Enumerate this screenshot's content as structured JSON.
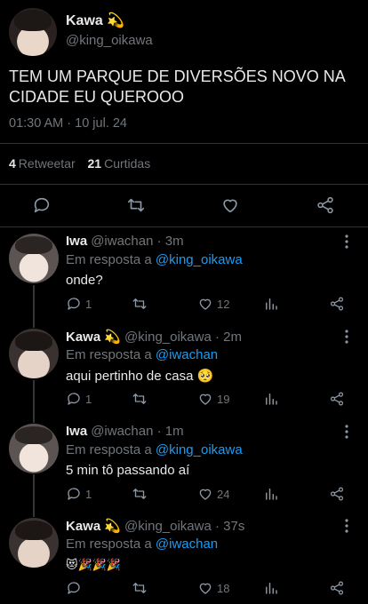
{
  "main_tweet": {
    "name": "Kawa",
    "name_emoji": "💫",
    "handle": "@king_oikawa",
    "text": "TEM UM PARQUE DE DIVERSÕES NOVO NA CIDADE EU QUEROOO",
    "time": "01:30 AM · 10 jul. 24",
    "retweets_count": "4",
    "retweets_label": "Retweetar",
    "likes_count": "21",
    "likes_label": "Curtidas"
  },
  "replies": [
    {
      "name": "Iwa",
      "handle_time": "@iwachan · 3m",
      "reply_prefix": "Em resposta a",
      "reply_to": "@king_oikawa",
      "text": "onde?",
      "replies": "1",
      "likes": "12"
    },
    {
      "name": "Kawa",
      "name_emoji": "💫",
      "handle_time": "@king_oikawa · 2m",
      "reply_prefix": "Em resposta a",
      "reply_to": "@iwachan",
      "text": "aqui pertinho de casa",
      "text_emoji": "🥺",
      "replies": "1",
      "likes": "19"
    },
    {
      "name": "Iwa",
      "handle_time": "@iwachan · 1m",
      "reply_prefix": "Em resposta a",
      "reply_to": "@king_oikawa",
      "text": "5 min tô passando aí",
      "replies": "1",
      "likes": "24"
    },
    {
      "name": "Kawa",
      "name_emoji": "💫",
      "handle_time": "@king_oikawa · 37s",
      "reply_prefix": "Em resposta a",
      "reply_to": "@iwachan",
      "text_emojis": "😻🎉🎉🎉",
      "replies": "",
      "likes": "18"
    }
  ],
  "icons": {
    "reply": "reply-icon",
    "retweet": "retweet-icon",
    "like": "heart-icon",
    "share": "share-icon",
    "analytics": "analytics-icon",
    "more": "more-vertical-icon"
  },
  "colors": {
    "background": "#000000",
    "text": "#e7e9ea",
    "muted": "#71767b",
    "link": "#1d9bf0",
    "divider": "#2f3336"
  }
}
